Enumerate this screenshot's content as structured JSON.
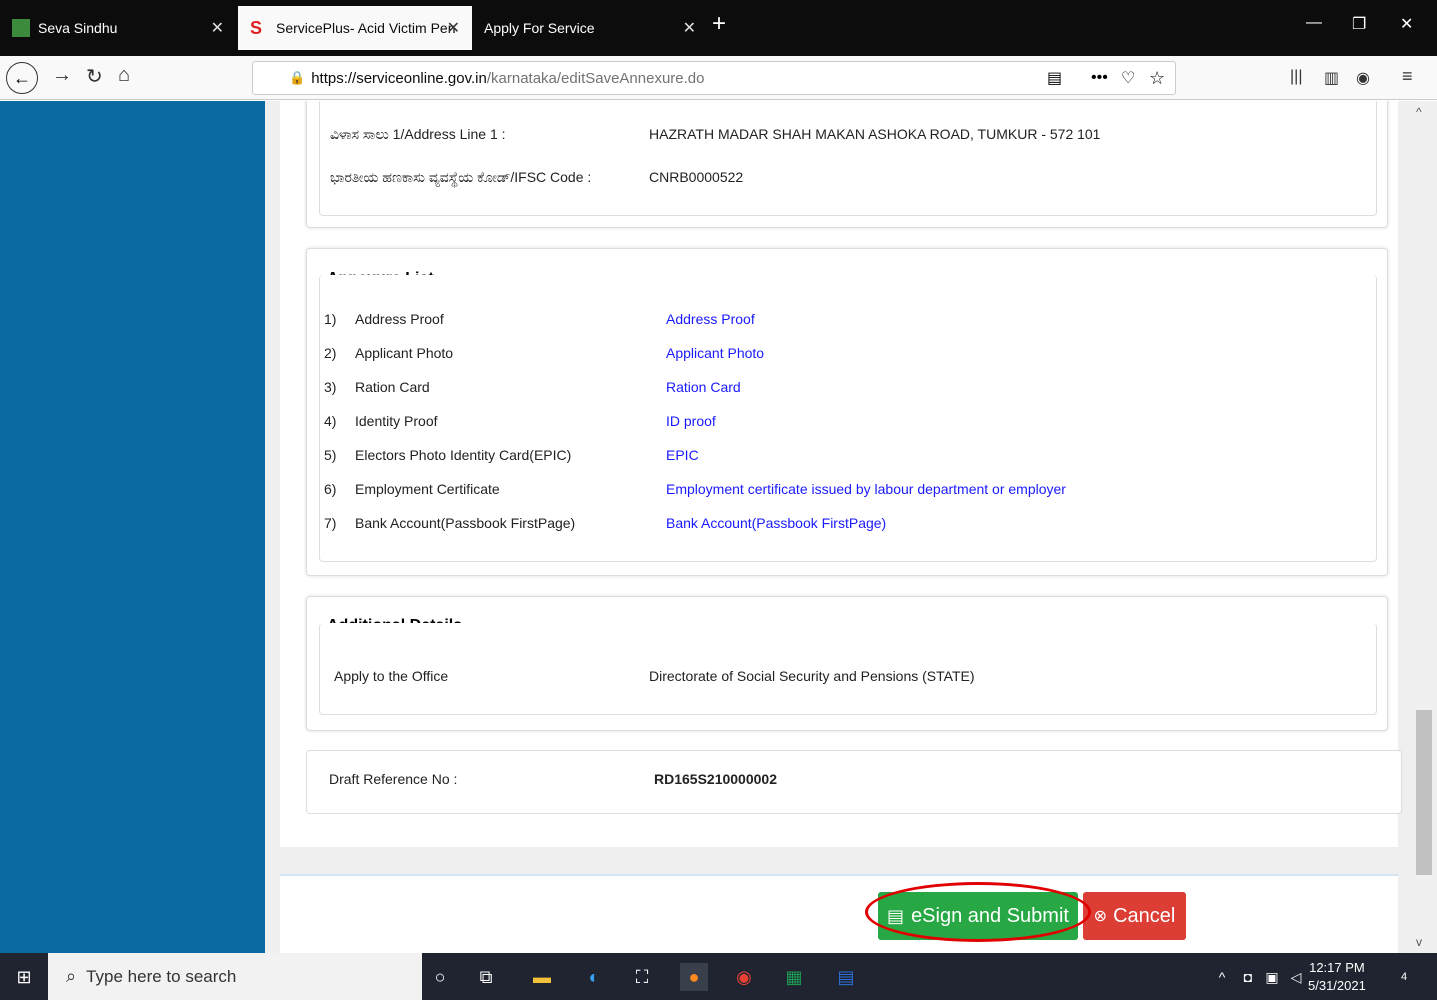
{
  "browser": {
    "tabs": [
      {
        "title": "Seva Sindhu"
      },
      {
        "title": "ServicePlus- Acid Victim Pensio"
      },
      {
        "title": "Apply For Service"
      }
    ],
    "url_host": "https://serviceonline.gov.in",
    "url_path": "/karnataka/editSaveAnnexure.do"
  },
  "bank": {
    "address_label": "ವಿಳಾಸ ಸಾಲು 1/Address Line 1 :",
    "address_value": "HAZRATH MADAR SHAH MAKAN ASHOKA ROAD, TUMKUR - 572 101",
    "ifsc_label": "ಭಾರತೀಯ ಹಣಕಾಸು ವ್ಯವಸ್ಥೆಯ ಕೋಡ್/IFSC Code :",
    "ifsc_value": "CNRB0000522"
  },
  "annexure": {
    "title": "Annexure List",
    "items": [
      {
        "num": "1)",
        "label": "Address Proof",
        "link": "Address Proof"
      },
      {
        "num": "2)",
        "label": "Applicant Photo",
        "link": "Applicant Photo"
      },
      {
        "num": "3)",
        "label": "Ration Card",
        "link": "Ration Card"
      },
      {
        "num": "4)",
        "label": "Identity Proof",
        "link": "ID proof"
      },
      {
        "num": "5)",
        "label": "Electors Photo Identity Card(EPIC)",
        "link": "EPIC"
      },
      {
        "num": "6)",
        "label": "Employment Certificate",
        "link": "Employment certificate issued by labour department or employer"
      },
      {
        "num": "7)",
        "label": "Bank Account(Passbook FirstPage)",
        "link": "Bank Account(Passbook FirstPage)"
      }
    ]
  },
  "additional": {
    "title": "Additional Details",
    "office_label": "Apply to the Office",
    "office_value": "Directorate of Social Security and Pensions (STATE)"
  },
  "draft": {
    "label": "Draft Reference No :",
    "value": "RD165S210000002"
  },
  "actions": {
    "esign_label": "eSign and Submit",
    "cancel_label": "Cancel"
  },
  "taskbar": {
    "search_placeholder": "Type here to search",
    "time": "12:17 PM",
    "date": "5/31/2021",
    "notification_count": "4"
  }
}
